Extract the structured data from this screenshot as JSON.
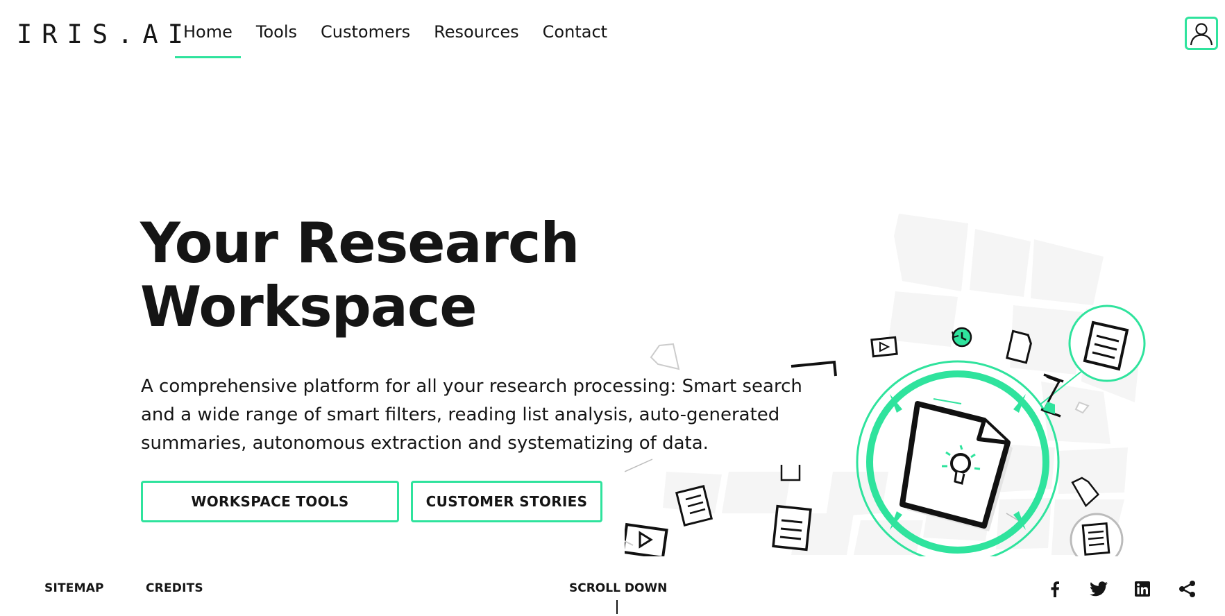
{
  "header": {
    "logo": "IRIS.AI",
    "nav": [
      "Home",
      "Tools",
      "Customers",
      "Resources",
      "Contact"
    ],
    "active_nav": "Home",
    "accent_color": "#2fe39d",
    "user_icon": "user-icon"
  },
  "hero": {
    "title_line1": "Your Research",
    "title_line2": "Workspace",
    "description_lines": [
      "A comprehensive platform for all your research processing: Smart search",
      "and a wide range of smart filters, reading list analysis, auto-generated",
      "summaries, autonomous extraction and systematizing of data."
    ],
    "buttons": {
      "tools": "WORKSPACE TOOLS",
      "stories": "CUSTOMER STORIES"
    }
  },
  "footer": {
    "sitemap": "SITEMAP",
    "credits": "CREDITS",
    "scroll_down": "SCROLL DOWN",
    "social_icons": [
      "facebook-icon",
      "twitter-icon",
      "linkedin-icon",
      "share-icon"
    ]
  }
}
